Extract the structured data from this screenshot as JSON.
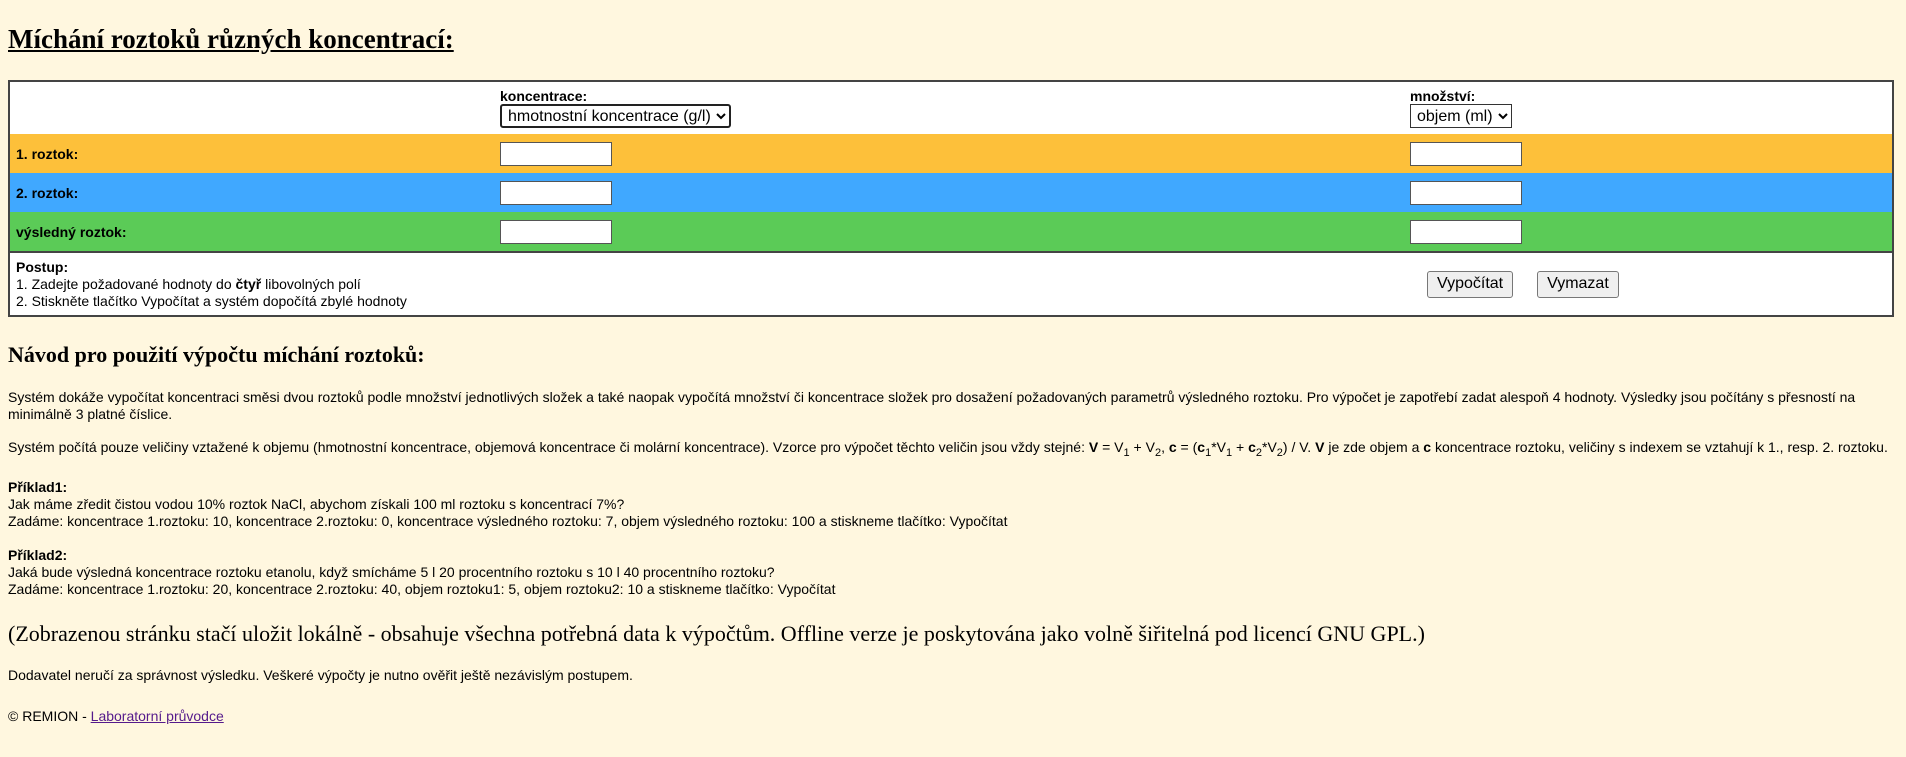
{
  "page": {
    "title": "Míchání roztoků různých koncentrací:"
  },
  "calculator": {
    "concentration_label": "koncentrace:",
    "concentration_selected": "hmotnostní koncentrace (g/l)",
    "amount_label": "množství:",
    "amount_selected": "objem (ml)",
    "rows": [
      {
        "label": "1. roztok:",
        "concentration": "",
        "amount": ""
      },
      {
        "label": "2. roztok:",
        "concentration": "",
        "amount": ""
      },
      {
        "label": "výsledný roztok:",
        "concentration": "",
        "amount": ""
      }
    ],
    "steps_title": "Postup:",
    "step1_prefix": "1. Zadejte požadované hodnoty do ",
    "step1_bold": "čtyř",
    "step1_suffix": " libovolných polí",
    "step2": "2. Stiskněte tlačítko Vypočítat a systém dopočítá zbylé hodnoty",
    "calculate_label": "Vypočítat",
    "clear_label": "Vymazat",
    "row_colors": [
      "#fdc03a",
      "#40a8ff",
      "#5bcb57"
    ]
  },
  "guide": {
    "heading": "Návod pro použití výpočtu míchání roztoků:",
    "paragraph1": "Systém dokáže vypočítat koncentraci směsi dvou roztoků podle množství jednotlivých složek a také naopak vypočítá množství či koncentrace složek pro dosažení požadovaných parametrů výsledného roztoku. Pro výpočet je zapotřebí zadat alespoň 4 hodnoty. Výsledky jsou počítány s přesností na minimálně 3 platné číslice.",
    "paragraph2_intro": "Systém počítá pouze veličiny vztažené k objemu (hmotnostní koncentrace, objemová koncentrace či molární koncentrace). Vzorce pro výpočet těchto veličin jsou vždy stejné: ",
    "paragraph2_outro": " je zde objem a ",
    "paragraph2_end": " koncentrace roztoku,  veličiny s indexem se vztahují k 1., resp. 2. roztoku.",
    "example1_title": "Příklad1:",
    "example1_q": "Jak máme zředit čistou vodou 10% roztok NaCl, abychom získali 100 ml roztoku s koncentrací 7%?",
    "example1_a": "Zadáme: koncentrace 1.roztoku: 10, koncentrace 2.roztoku: 0, koncentrace výsledného roztoku: 7, objem výsledného roztoku: 100 a stiskneme tlačítko: Vypočítat",
    "example2_title": "Příklad2:",
    "example2_q": "Jaká bude výsledná koncentrace roztoku etanolu, když smícháme 5 l 20 procentního roztoku s 10 l 40 procentního roztoku?",
    "example2_a": "Zadáme: koncentrace 1.roztoku: 20, koncentrace 2.roztoku: 40, objem roztoku1: 5, objem roztoku2: 10 a stiskneme tlačítko: Vypočítat",
    "offline_note": "(Zobrazenou stránku stačí uložit lokálně - obsahuje všechna potřebná data k výpočtům. Offline verze je poskytována jako volně šiřitelná pod licencí GNU GPL.)",
    "disclaimer": "Dodavatel neručí za správnost výsledku. Veškeré výpočty je nutno ověřit ještě nezávislým postupem.",
    "footer_prefix": "© REMION - ",
    "footer_link": "Laboratorní průvodce"
  }
}
